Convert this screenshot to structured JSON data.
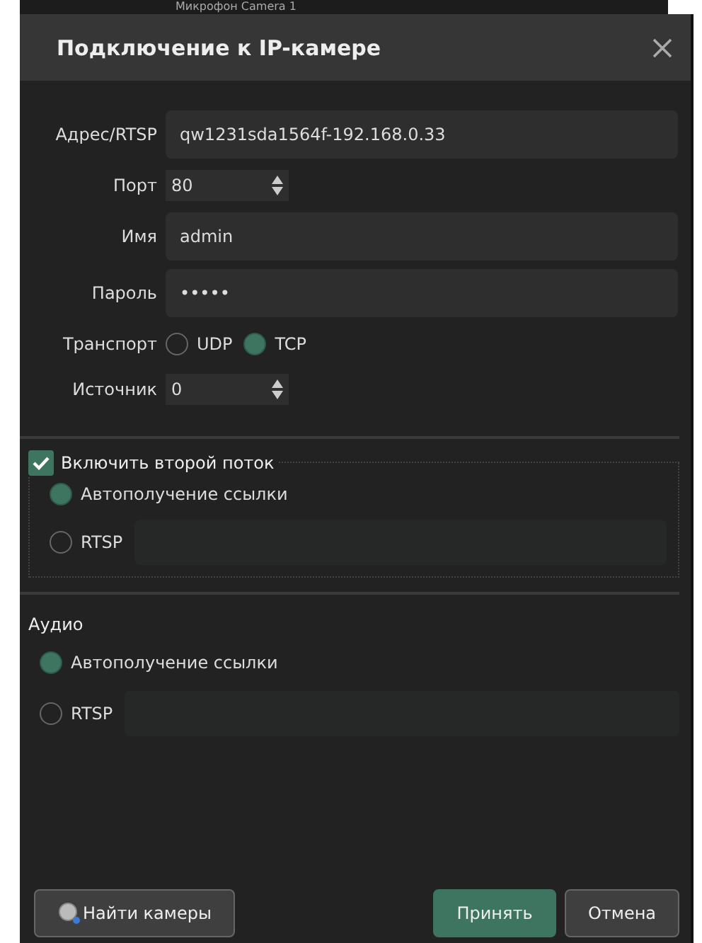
{
  "background_window": {
    "title": "Микрофон Camera 1"
  },
  "dialog": {
    "title": "Подключение к IP-камере",
    "fields": [
      {
        "kind": "text",
        "label": "Адрес/RTSP",
        "value": "qw1231sda1564f-192.168.0.33"
      },
      {
        "kind": "spin",
        "label": "Порт",
        "value": "80"
      },
      {
        "kind": "text",
        "label": "Имя",
        "value": "admin"
      },
      {
        "kind": "password",
        "label": "Пароль",
        "value": "•••••"
      },
      {
        "kind": "radio",
        "label": "Транспорт",
        "options": [
          {
            "label": "UDP",
            "selected": false
          },
          {
            "label": "TCP",
            "selected": true
          }
        ]
      },
      {
        "kind": "spin",
        "label": "Источник",
        "value": "0"
      }
    ],
    "second_stream": {
      "label": "Включить второй поток",
      "checked": true,
      "options": [
        {
          "kind": "auto",
          "label": "Автополучение ссылки",
          "selected": true
        },
        {
          "kind": "rtsp",
          "label": "RTSP",
          "selected": false
        }
      ]
    },
    "audio": {
      "title": "Аудио",
      "options": [
        {
          "kind": "auto",
          "label": "Автополучение ссылки",
          "selected": true
        },
        {
          "kind": "rtsp",
          "label": "RTSP",
          "selected": false
        }
      ]
    },
    "buttons": [
      {
        "kind": "find",
        "label": "Найти камеры"
      },
      {
        "kind": "primary",
        "label": "Принять"
      },
      {
        "kind": "secondary",
        "label": "Отмена"
      }
    ]
  }
}
